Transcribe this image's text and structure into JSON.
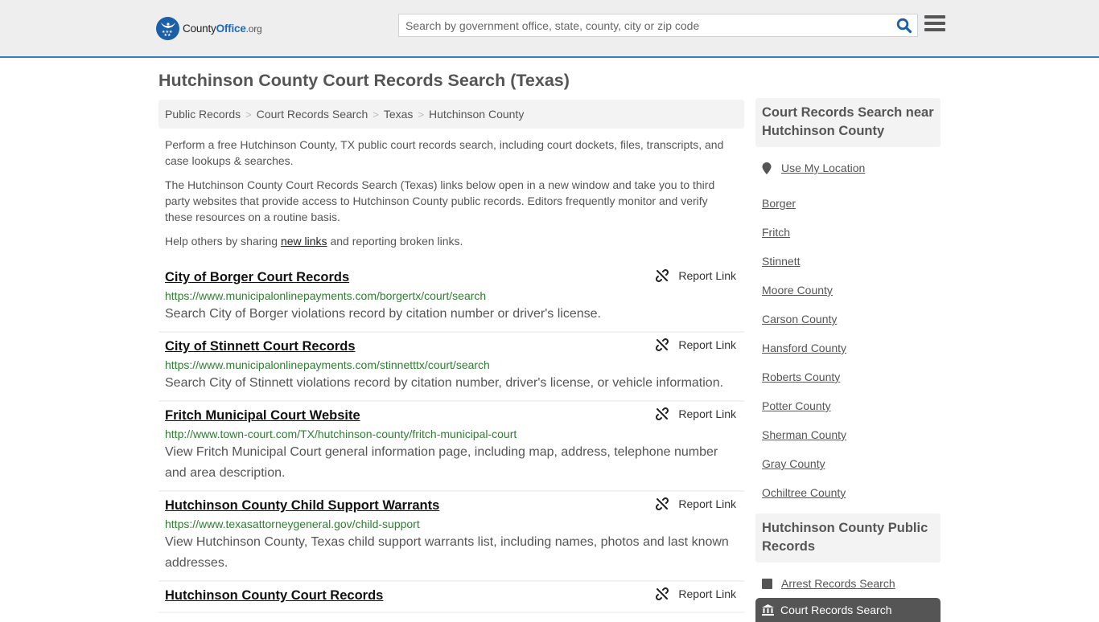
{
  "header": {
    "logo": {
      "text_main": "County",
      "text_brand": "Office",
      "text_tld": ".org"
    },
    "search": {
      "placeholder": "Search by government office, state, county, city or zip code",
      "value": ""
    },
    "icons": {
      "search": "search-icon",
      "menu": "hamburger-menu-icon"
    }
  },
  "page": {
    "title": "Hutchinson County Court Records Search (Texas)"
  },
  "breadcrumb": [
    {
      "label": "Public Records"
    },
    {
      "label": "Court Records Search"
    },
    {
      "label": "Texas"
    },
    {
      "label": "Hutchinson County"
    }
  ],
  "breadcrumb_separator": ">",
  "intro": {
    "p1": "Perform a free Hutchinson County, TX public court records search, including court dockets, files, transcripts, and case lookups & searches.",
    "p2": "The Hutchinson County Court Records Search (Texas) links below open in a new window and take you to third party websites that provide access to Hutchinson County public records. Editors frequently monitor and verify these resources on a routine basis.",
    "p3_before": "Help others by sharing ",
    "p3_link": "new links",
    "p3_after": " and reporting broken links."
  },
  "listings": [
    {
      "title": "City of Borger Court Records",
      "url": "https://www.municipalonlinepayments.com/borgertx/court/search",
      "description": "Search City of Borger violations record by citation number or driver's license.",
      "report_label": "Report Link"
    },
    {
      "title": "City of Stinnett Court Records",
      "url": "https://www.municipalonlinepayments.com/stinnetttx/court/search",
      "description": "Search City of Stinnett violations record by citation number, driver's license, or vehicle information.",
      "report_label": "Report Link"
    },
    {
      "title": "Fritch Municipal Court Website",
      "url": "http://www.town-court.com/TX/hutchinson-county/fritch-municipal-court",
      "description": "View Fritch Municipal Court general information page, including map, address, telephone number and area description.",
      "report_label": "Report Link"
    },
    {
      "title": "Hutchinson County Child Support Warrants",
      "url": "https://www.texasattorneygeneral.gov/child-support",
      "description": "View Hutchinson County, Texas child support warrants list, including names, photos and last known addresses.",
      "report_label": "Report Link"
    },
    {
      "title": "Hutchinson County Court Records",
      "url": "",
      "description": "",
      "report_label": "Report Link"
    }
  ],
  "sidebar": {
    "nearby": {
      "heading": "Court Records Search near Hutchinson County",
      "use_location": "Use My Location",
      "items": [
        "Borger",
        "Fritch",
        "Stinnett",
        "Moore County",
        "Carson County",
        "Hansford County",
        "Roberts County",
        "Potter County",
        "Sherman County",
        "Gray County",
        "Ochiltree County"
      ]
    },
    "public_records": {
      "heading": "Hutchinson County Public Records",
      "items": [
        {
          "label": "Arrest Records Search",
          "icon": "square-icon",
          "active": false
        },
        {
          "label": "Court Records Search",
          "icon": "courthouse-icon",
          "active": true
        }
      ]
    }
  },
  "colors": {
    "accent": "#3b7bbf",
    "url_green": "#2f7d32",
    "header_bg": "#eeeeee",
    "panel_bg": "#f3f3f3",
    "active_bg": "#555555",
    "logo_blue": "#1b5fa8"
  }
}
